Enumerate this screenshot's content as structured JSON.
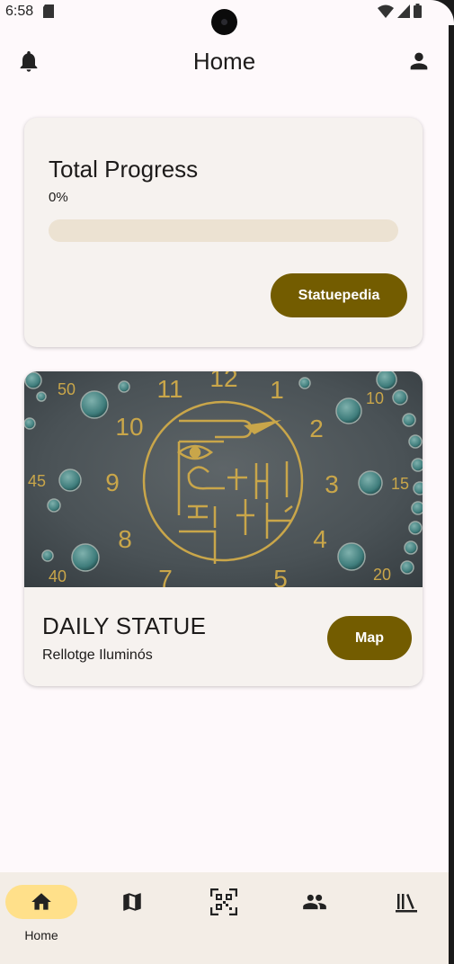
{
  "status_bar": {
    "time": "6:58"
  },
  "top_bar": {
    "title": "Home",
    "left_icon": "bell-icon",
    "right_icon": "person-icon"
  },
  "progress_card": {
    "title": "Total Progress",
    "value_text": "0%",
    "progress_fraction": 0,
    "button_label": "Statuepedia"
  },
  "daily_card": {
    "image_icon": "clock-statue-photo",
    "heading": "DAILY STATUE",
    "statue_name": "Rellotge Iluminós",
    "button_label": "Map"
  },
  "bottom_nav": {
    "items": [
      {
        "icon": "home-icon",
        "label": "Home",
        "active": true
      },
      {
        "icon": "map-icon",
        "label": "",
        "active": false
      },
      {
        "icon": "qr-code-icon",
        "label": "",
        "active": false
      },
      {
        "icon": "people-icon",
        "label": "",
        "active": false
      },
      {
        "icon": "library-icon",
        "label": "",
        "active": false
      }
    ]
  },
  "colors": {
    "primary": "#735c00",
    "background": "#fef9fb",
    "card": "#f6f2ef",
    "progress_track": "#ece2d2",
    "active_nav": "#ffe08a",
    "nav_bar": "#f3ede6"
  },
  "clock_numbers": [
    "12",
    "1",
    "2",
    "3",
    "4",
    "5",
    "7",
    "8",
    "9",
    "10",
    "11",
    "15",
    "20",
    "40",
    "45",
    "50",
    "10"
  ]
}
